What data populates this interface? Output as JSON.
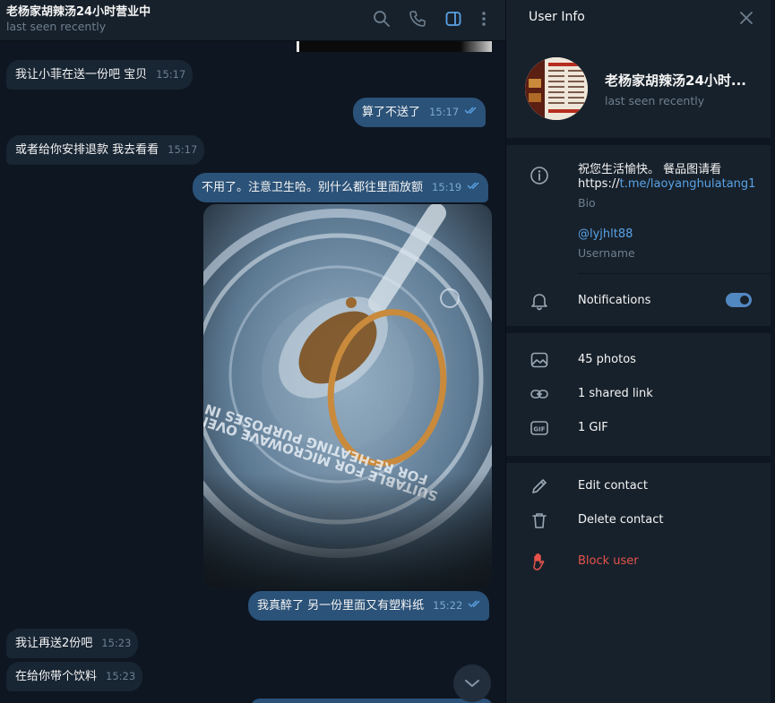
{
  "chat": {
    "title": "老杨家胡辣汤24小时营业中",
    "status": "last seen recently",
    "messages": [
      {
        "dir": "in",
        "text": "我让小菲在送一份吧 宝贝",
        "time": "15:17"
      },
      {
        "dir": "out",
        "text": "算了不送了",
        "time": "15:17"
      },
      {
        "dir": "in",
        "text": "或者给你安排退款 我去看看",
        "time": "15:17"
      },
      {
        "dir": "out",
        "text": "不用了。注意卫生哈。别什么都往里面放额",
        "time": "15:19"
      },
      {
        "dir": "out",
        "text": "我真醉了 另一份里面又有塑料纸",
        "time": "15:22"
      },
      {
        "dir": "in",
        "text": "我让再送2份吧",
        "time": "15:23"
      },
      {
        "dir": "in",
        "text": "在给你带个饮料",
        "time": "15:23"
      }
    ],
    "photo_lid_text": [
      "FOR RE-HEATING PURPOSES IN",
      "SUITABLE FOR MICROWAVE OVENS"
    ]
  },
  "user_info": {
    "panel_title": "User Info",
    "name": "老杨家胡辣汤24小时...",
    "status": "last seen recently",
    "bio_text": "祝您生活愉快。 餐品图请看",
    "bio_link_prefix": "https://",
    "bio_link": "t.me/laoyanghulatang1",
    "bio_label": "Bio",
    "username": "@lyjhlt88",
    "username_label": "Username",
    "notifications_label": "Notifications",
    "notifications_on": true,
    "media": {
      "photos": "45 photos",
      "links": "1 shared link",
      "gifs": "1 GIF"
    },
    "actions": {
      "edit": "Edit contact",
      "delete": "Delete contact",
      "block": "Block user"
    }
  },
  "colors": {
    "chat_bg": "#0e1621",
    "panel_bg": "#17212b",
    "incoming_bubble": "#182533",
    "outgoing_bubble": "#2b5278",
    "accent": "#5288c1",
    "danger": "#e5534b"
  },
  "icons": [
    "search-icon",
    "phone-icon",
    "sidebar-toggle-icon",
    "more-vertical-icon",
    "close-icon",
    "info-icon",
    "bell-icon",
    "photo-icon",
    "link-icon",
    "gif-icon",
    "pencil-icon",
    "trash-icon",
    "hand-icon",
    "chevron-down-icon",
    "read-ticks-icon"
  ]
}
